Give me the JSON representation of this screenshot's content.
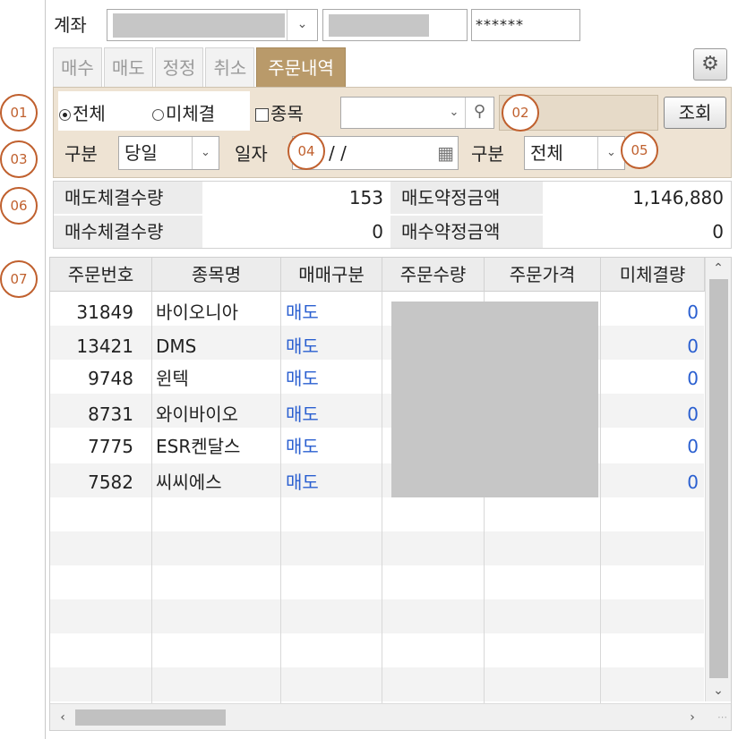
{
  "account": {
    "label": "계좌",
    "password_mask": "******",
    "dropdown_icon": "chevron-down-icon"
  },
  "tabs": [
    {
      "label": "매수",
      "active": false
    },
    {
      "label": "매도",
      "active": false
    },
    {
      "label": "정정",
      "active": false
    },
    {
      "label": "취소",
      "active": false
    },
    {
      "label": "주문내역",
      "active": true
    }
  ],
  "settings_icon": "gear-icon",
  "filter": {
    "radio_all": "전체",
    "radio_unfilled": "미체결",
    "checkbox_stock": "종목",
    "query_button": "조회",
    "type_label": "구분",
    "type_value": "당일",
    "date_label": "일자",
    "date_value": "/ /",
    "type2_label": "구분",
    "type2_value": "전체"
  },
  "summary": {
    "sell_qty_label": "매도체결수량",
    "sell_qty": "153",
    "sell_amt_label": "매도약정금액",
    "sell_amt": "1,146,880",
    "buy_qty_label": "매수체결수량",
    "buy_qty": "0",
    "buy_amt_label": "매수약정금액",
    "buy_amt": "0"
  },
  "table": {
    "columns": [
      "주문번호",
      "종목명",
      "매매구분",
      "주문수량",
      "주문가격",
      "미체결량"
    ],
    "rows": [
      {
        "no": "31849",
        "name": "바이오니아",
        "side": "매도",
        "unfilled": "0"
      },
      {
        "no": "13421",
        "name": "DMS",
        "side": "매도",
        "unfilled": "0"
      },
      {
        "no": "9748",
        "name": "윈텍",
        "side": "매도",
        "unfilled": "0"
      },
      {
        "no": "8731",
        "name": "와이바이오",
        "side": "매도",
        "unfilled": "0"
      },
      {
        "no": "7775",
        "name": "ESR켄달스",
        "side": "매도",
        "unfilled": "0"
      },
      {
        "no": "7582",
        "name": "씨씨에스",
        "side": "매도",
        "unfilled": "0"
      }
    ]
  },
  "callouts": [
    "01",
    "02",
    "03",
    "04",
    "05",
    "06",
    "07"
  ],
  "colors": {
    "active_tab": "#b99a6a",
    "panel_bg": "#eee3d3",
    "sell_blue": "#2a5fd0",
    "callout": "#c0602e"
  }
}
